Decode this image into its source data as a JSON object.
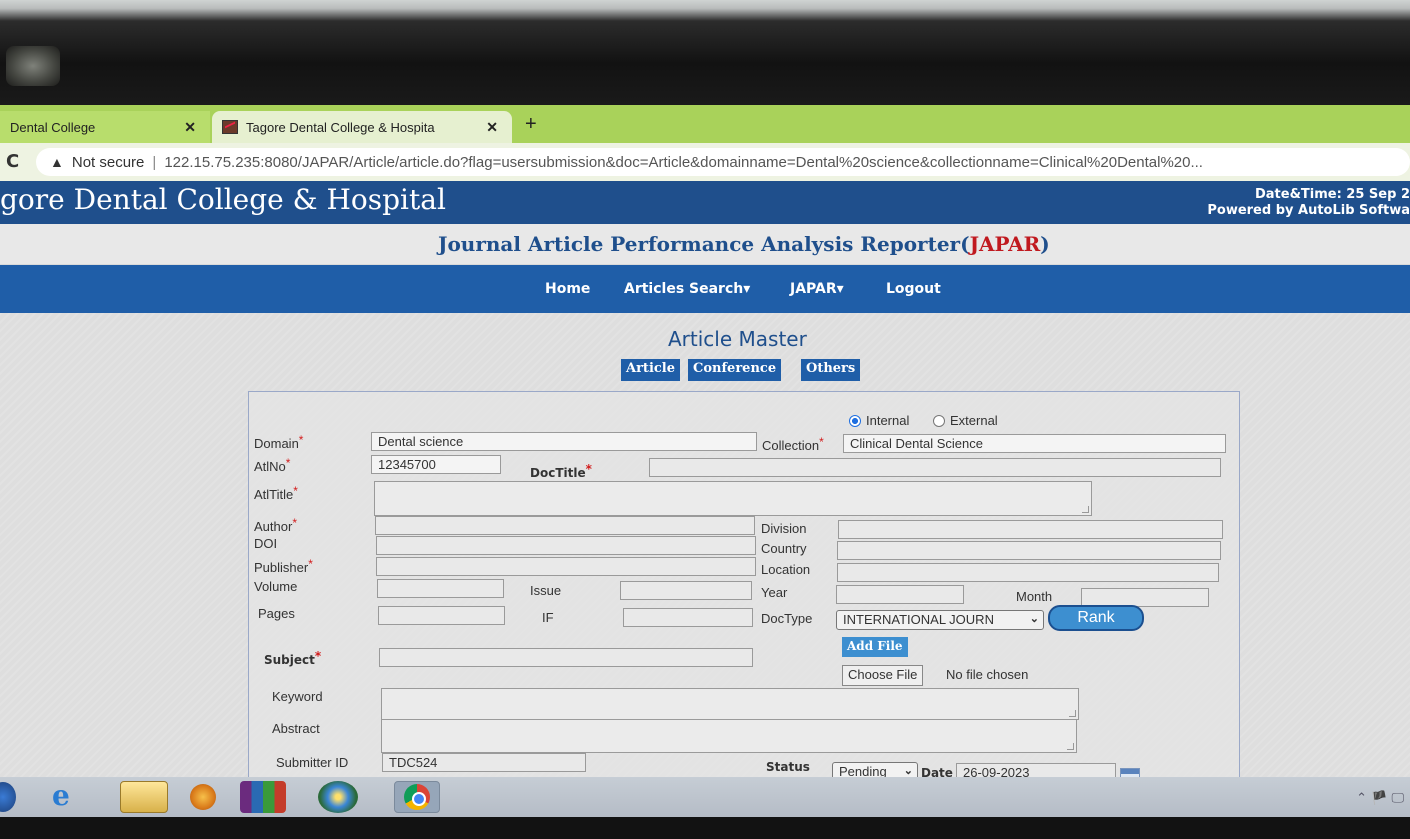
{
  "browser": {
    "tabs": [
      {
        "label": "Dental College",
        "active": false
      },
      {
        "label": "Tagore Dental College & Hospita",
        "active": true
      }
    ],
    "new_tab": "+",
    "security": "Not secure",
    "url": "122.15.75.235:8080/JAPAR/Article/article.do?flag=usersubmission&doc=Article&domainname=Dental%20science&collectionname=Clinical%20Dental%20..."
  },
  "header": {
    "college": "gore Dental College & Hospital",
    "datetime_line": "Date&Time:  25 Sep 2",
    "powered_by": "Powered by AutoLib Softwa"
  },
  "subheader": {
    "title_main": "Journal Article Performance Analysis Reporter(",
    "title_abbr": "JAPAR",
    "title_close": ")"
  },
  "nav": {
    "home": "Home",
    "articles_search": "Articles Search▾",
    "japar": "JAPAR▾",
    "logout": "Logout"
  },
  "page": {
    "title": "Article Master",
    "tabs": [
      "Article",
      "Conference",
      "Others"
    ]
  },
  "form": {
    "source": {
      "internal": "Internal",
      "external": "External",
      "selected": "Internal"
    },
    "domain_label": "Domain",
    "domain_value": "Dental science",
    "collection_label": "Collection",
    "collection_value": "Clinical Dental Science",
    "atlno_label": "AtlNo",
    "atlno_value": "12345700",
    "doctitle_label": "DocTitle",
    "atltitle_label": "AtlTitle",
    "author_label": "Author",
    "division_label": "Division",
    "doi_label": "DOI",
    "country_label": "Country",
    "publisher_label": "Publisher",
    "location_label": "Location",
    "volume_label": "Volume",
    "issue_label": "Issue",
    "year_label": "Year",
    "month_label": "Month",
    "pages_label": "Pages",
    "if_label": "IF",
    "doctype_label": "DocType",
    "doctype_value": "INTERNATIONAL JOURN",
    "rank_label": "Rank",
    "subject_label": "Subject",
    "add_file_label": "Add File",
    "choose_file_label": "Choose File",
    "no_file_text": "No file chosen",
    "keyword_label": "Keyword",
    "abstract_label": "Abstract",
    "submitter_label": "Submitter ID",
    "submitter_value": "TDC524",
    "status_label": "Status",
    "status_value": "Pending",
    "date_label": "Date",
    "date_value": "26-09-2023",
    "required_mark": "*"
  },
  "taskbar": {
    "icons": [
      "start-icon",
      "internet-explorer-icon",
      "folder-icon",
      "media-player-icon",
      "winrar-icon",
      "paint-icon",
      "chrome-icon"
    ],
    "tray": "⌃ 🏴 🖵"
  }
}
